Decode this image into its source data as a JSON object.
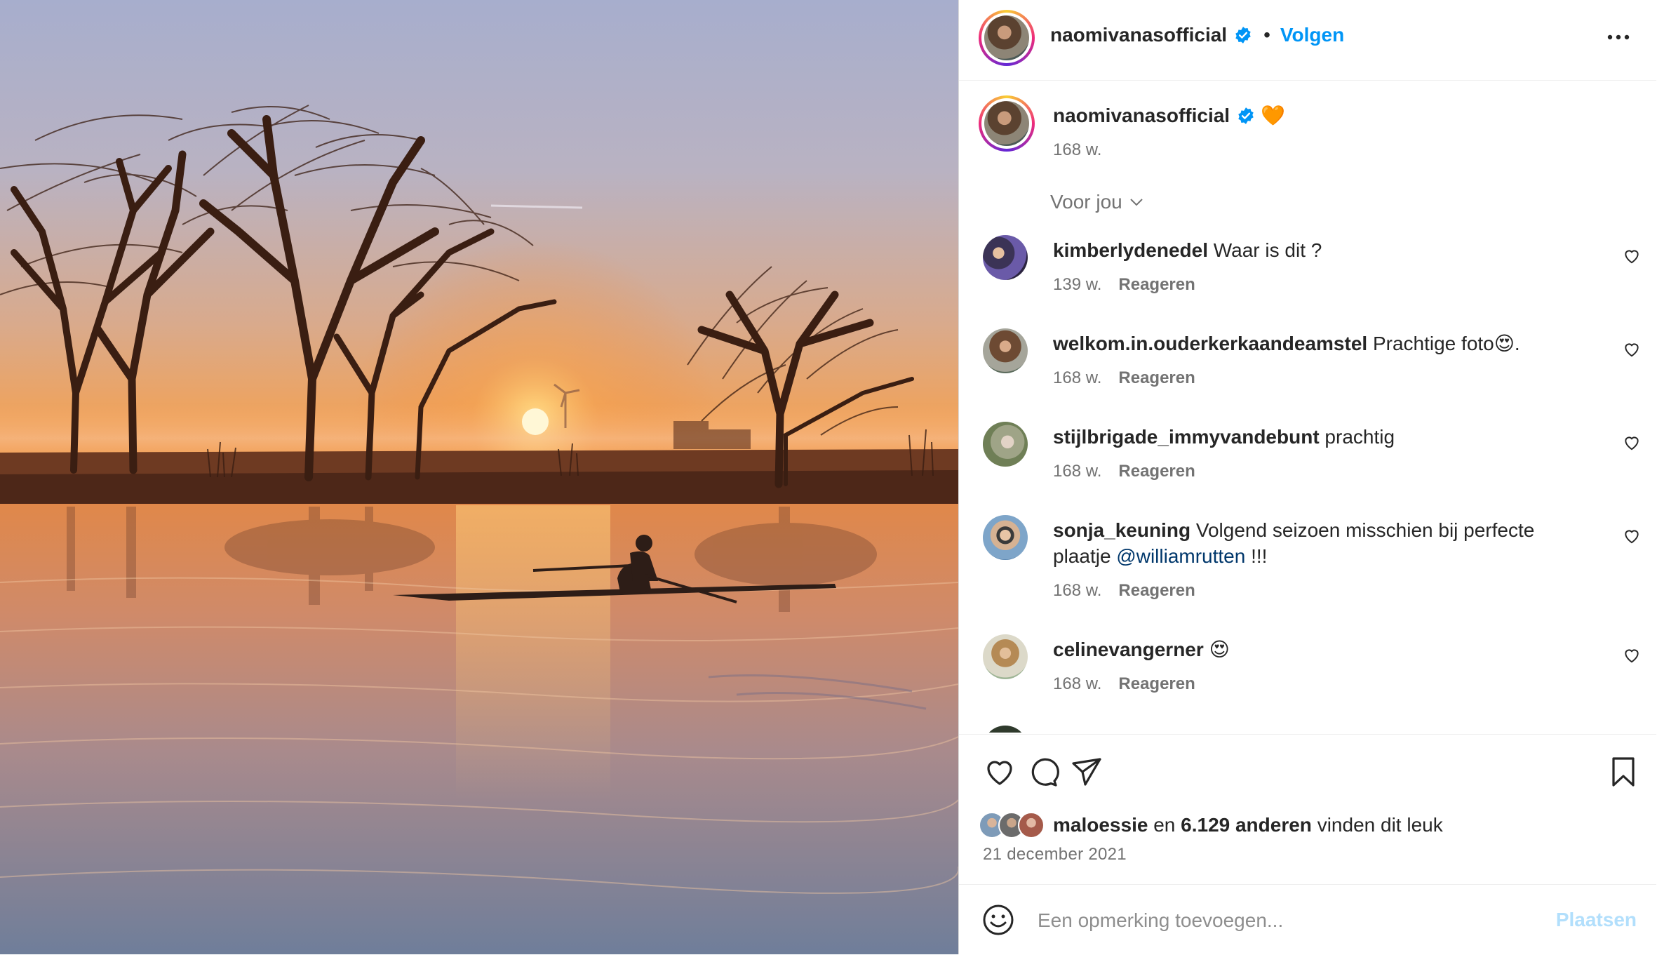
{
  "post": {
    "author": "naomivanasofficial",
    "separator": "•",
    "follow_label": "Volgen",
    "more_icon": "more-horizontal-icon",
    "caption_emoji": "🧡",
    "caption_age": "168 w.",
    "sort_label": "Voor jou",
    "verified_color": "#0095f6"
  },
  "comments": [
    {
      "user": "kimberlydenedel",
      "text": "Waar is dit ?",
      "mention": "",
      "text_after": "",
      "age": "139 w.",
      "reply": "Reageren"
    },
    {
      "user": "welkom.in.ouderkerkaandeamstel",
      "text": "Prachtige foto😍.",
      "mention": "",
      "text_after": "",
      "age": "168 w.",
      "reply": "Reageren"
    },
    {
      "user": "stijlbrigade_immyvandebunt",
      "text": "prachtig",
      "mention": "",
      "text_after": "",
      "age": "168 w.",
      "reply": "Reageren"
    },
    {
      "user": "sonja_keuning",
      "text": "Volgend seizoen misschien bij perfecte plaatje",
      "mention": "@williamrutten",
      "text_after": " !!!",
      "age": "168 w.",
      "reply": "Reageren"
    },
    {
      "user": "celinevangerner",
      "text": "😍",
      "mention": "",
      "text_after": "",
      "age": "168 w.",
      "reply": "Reageren"
    }
  ],
  "likes": {
    "user": "maloessie",
    "joiner": "en",
    "count": "6.129 anderen",
    "suffix": "vinden dit leuk"
  },
  "date": "21 december 2021",
  "add_comment": {
    "placeholder": "Een opmerking toevoegen...",
    "post_label": "Plaatsen"
  }
}
